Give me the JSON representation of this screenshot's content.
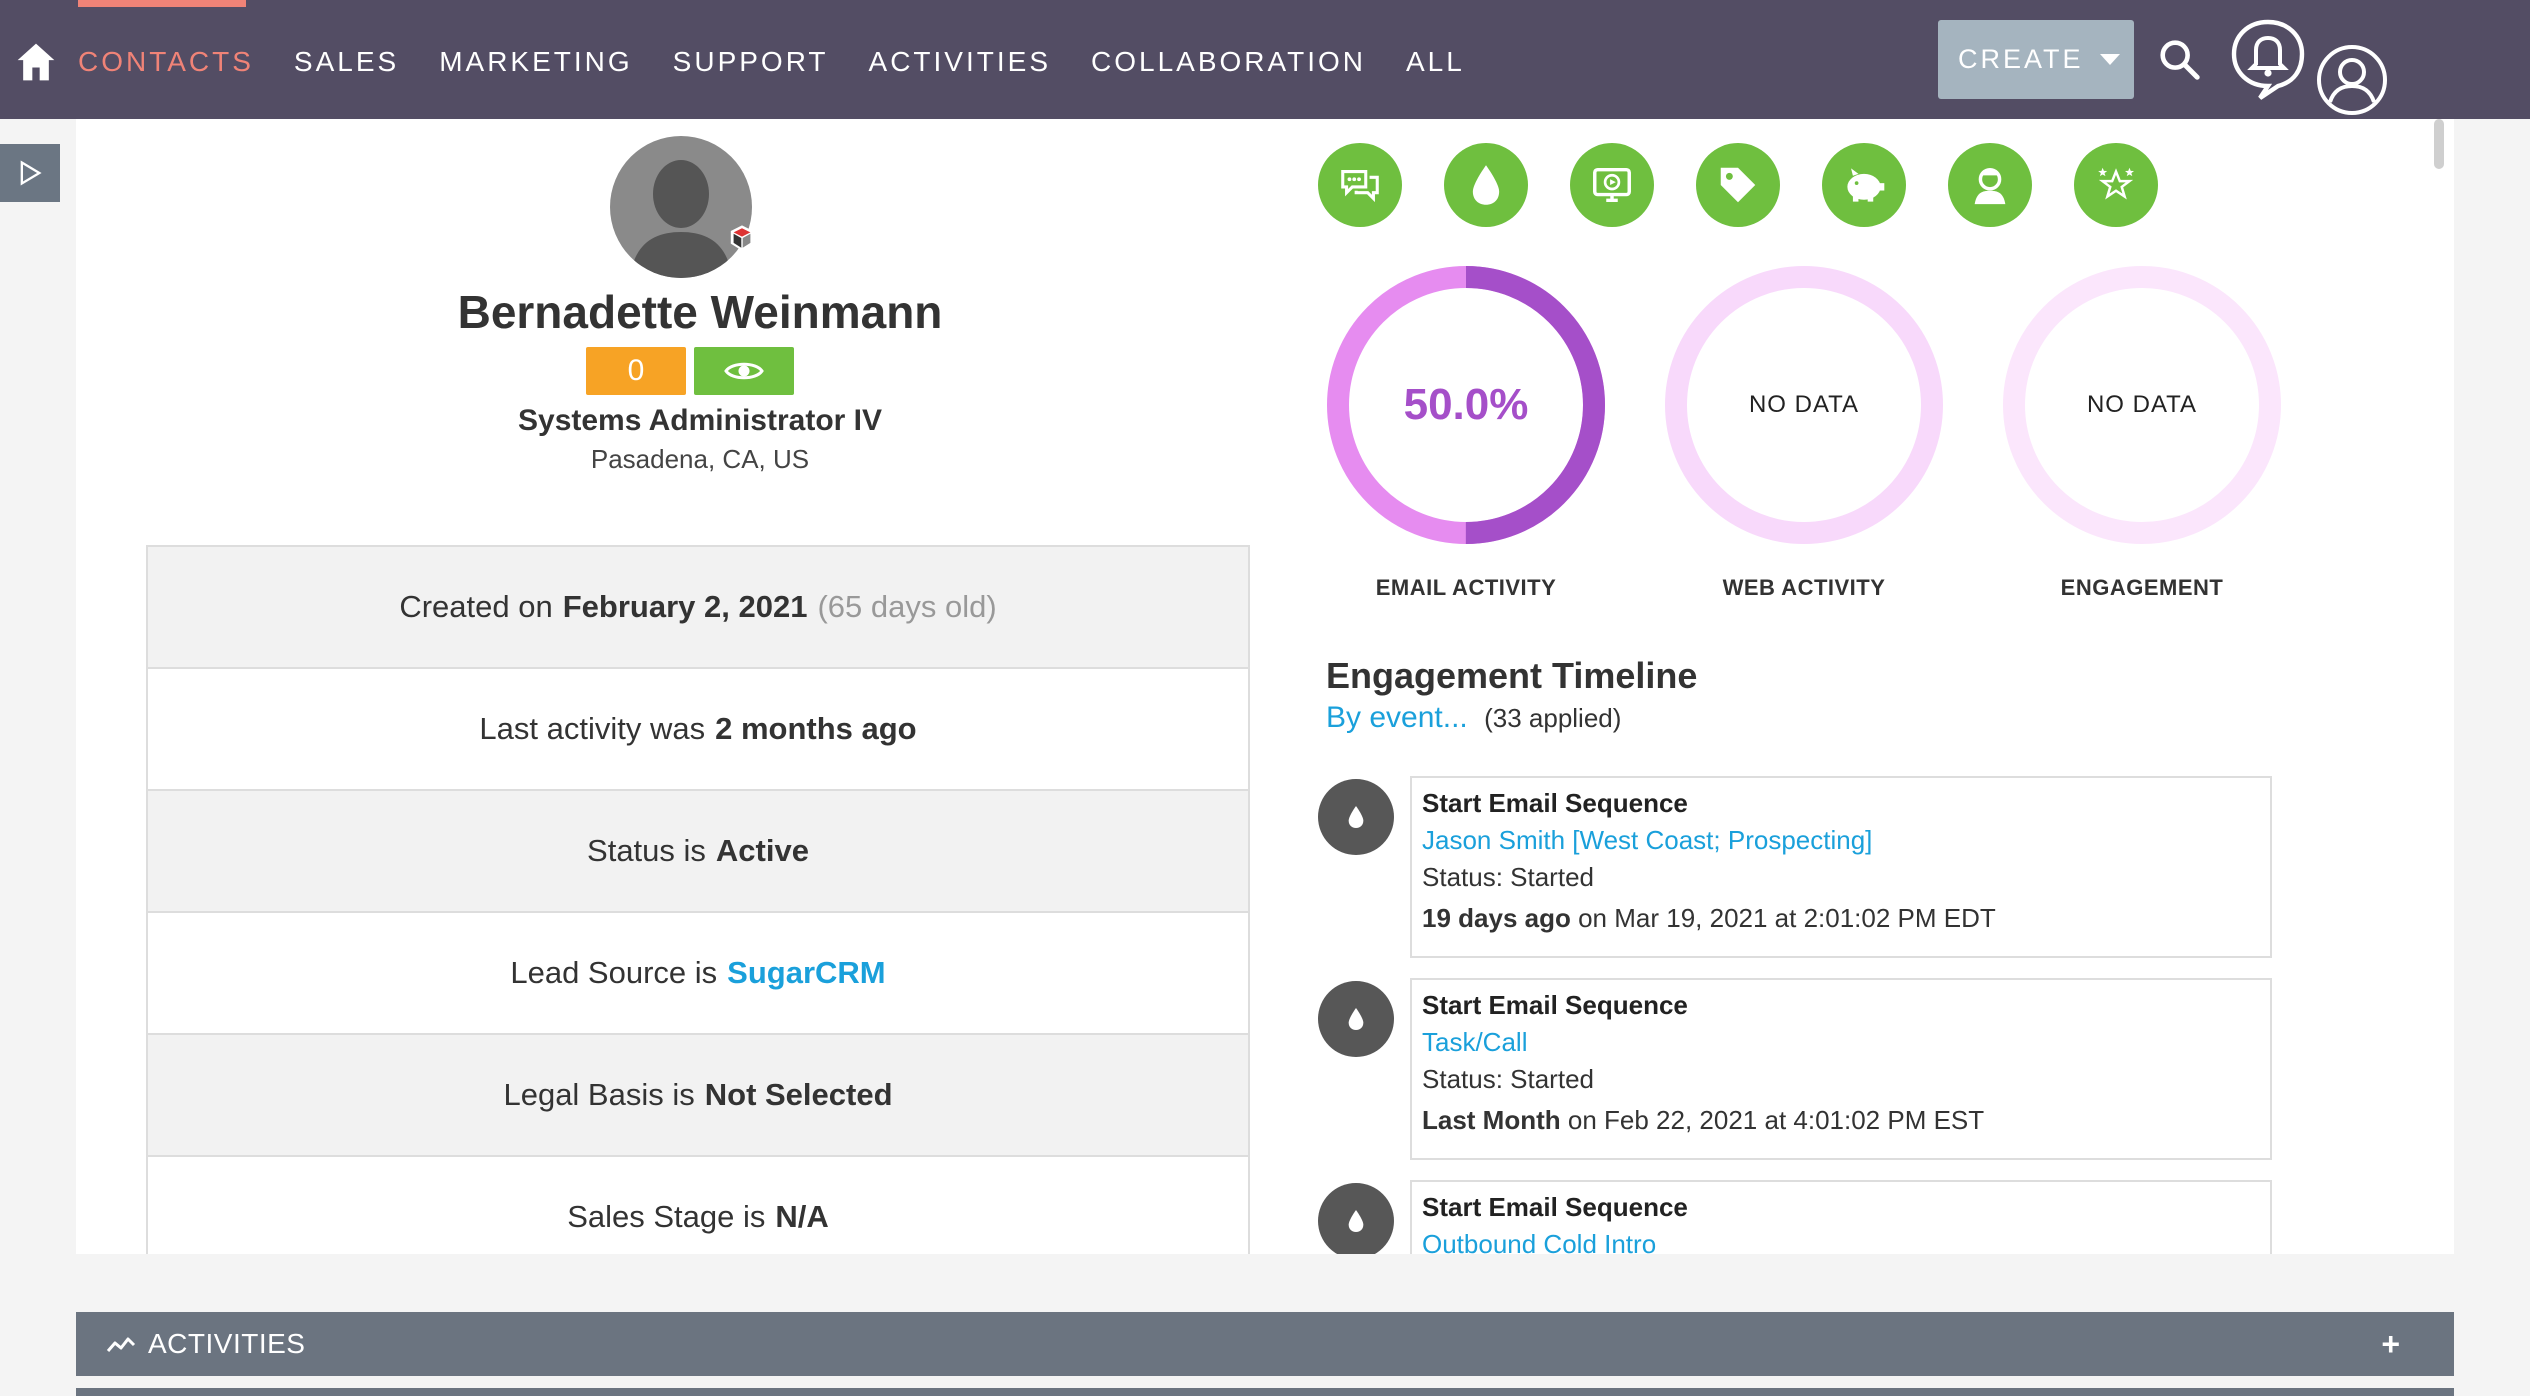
{
  "nav": {
    "items": [
      "CONTACTS",
      "SALES",
      "MARKETING",
      "SUPPORT",
      "ACTIVITIES",
      "COLLABORATION",
      "ALL"
    ],
    "active": "CONTACTS",
    "create_label": "CREATE"
  },
  "profile": {
    "name": "Bernadette Weinmann",
    "score": "0",
    "title": "Systems Administrator IV",
    "location": "Pasadena, CA, US"
  },
  "info": {
    "created_prefix": "Created on",
    "created_date": "February 2, 2021",
    "created_age": "(65 days old)",
    "activity_prefix": "Last activity was",
    "activity_value": "2 months ago",
    "status_prefix": "Status is",
    "status_value": "Active",
    "lead_prefix": "Lead Source is",
    "lead_value": "SugarCRM",
    "legal_prefix": "Legal Basis is",
    "legal_value": "Not Selected",
    "stage_prefix": "Sales Stage is",
    "stage_value": "N/A"
  },
  "icons": [
    "chat-icon",
    "drop-icon",
    "video-icon",
    "tag-icon",
    "piggy-bank-icon",
    "person-icon",
    "stars-icon"
  ],
  "colors": {
    "nav_bg": "#534d64",
    "accent": "#f08377",
    "green": "#6fbf3f",
    "link": "#1aa0db",
    "purple": "#a54fc9"
  },
  "rings": [
    {
      "label": "EMAIL ACTIVITY",
      "value": "50.0%",
      "fraction": 0.5
    },
    {
      "label": "WEB ACTIVITY",
      "value": "NO DATA"
    },
    {
      "label": "ENGAGEMENT",
      "value": "NO DATA"
    }
  ],
  "timeline": {
    "title": "Engagement Timeline",
    "filter_link": "By event...",
    "filter_count": "(33 applied)",
    "events": [
      {
        "title": "Start Email Sequence",
        "link": "Jason Smith [West Coast; Prospecting]",
        "status": "Status: Started",
        "relative": "19 days ago",
        "absolute": "on Mar 19, 2021 at 2:01:02 PM EDT"
      },
      {
        "title": "Start Email Sequence",
        "link": "Task/Call",
        "status": "Status: Started",
        "relative": "Last Month",
        "absolute": "on Feb 22, 2021 at 4:01:02 PM EST"
      },
      {
        "title": "Start Email Sequence",
        "link": "Outbound Cold Intro",
        "status": "",
        "relative": "",
        "absolute": ""
      }
    ]
  },
  "bottom": {
    "activities_label": "ACTIVITIES",
    "plus": "+"
  }
}
